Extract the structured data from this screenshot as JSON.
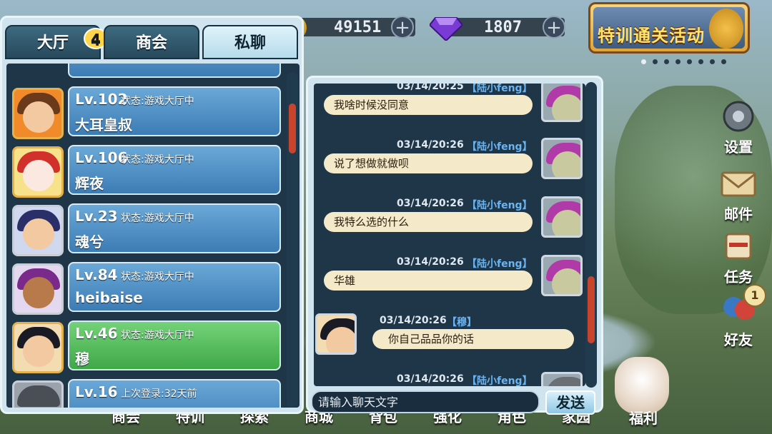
{
  "currency": {
    "coins": "49151",
    "gems": "1807"
  },
  "event_banner": {
    "title": "特训通关活动"
  },
  "side_menu": [
    {
      "label": "设置",
      "icon": "gear-icon"
    },
    {
      "label": "邮件",
      "icon": "mail-icon"
    },
    {
      "label": "任务",
      "icon": "scroll-icon"
    },
    {
      "label": "好友",
      "icon": "friends-icon",
      "badge": "1"
    }
  ],
  "bottom_nav": [
    "商会",
    "特训",
    "探索",
    "商城",
    "背包",
    "强化",
    "角色",
    "家园",
    "福利"
  ],
  "left_panel": {
    "tabs": [
      {
        "label": "大厅",
        "badge": "4"
      },
      {
        "label": "商会"
      },
      {
        "label": "私聊",
        "active": true
      }
    ],
    "friends": [
      {
        "level": "Lv.102",
        "status": "状态:游戏大厅中",
        "name": "大耳皇叔",
        "hl": false
      },
      {
        "level": "Lv.106",
        "status": "状态:游戏大厅中",
        "name": "辉夜",
        "hl": false
      },
      {
        "level": "Lv.23",
        "status": "状态:游戏大厅中",
        "name": "魂兮",
        "hl": false
      },
      {
        "level": "Lv.84",
        "status": "状态:游戏大厅中",
        "name": "heibaise",
        "hl": false
      },
      {
        "level": "Lv.46",
        "status": "状态:游戏大厅中",
        "name": "穆",
        "hl": true
      },
      {
        "level": "Lv.16",
        "status": "上次登录:32天前",
        "name": "",
        "hl": false
      }
    ]
  },
  "chat": {
    "messages": [
      {
        "time": "03/14/20:25",
        "name": "【陆小feng】",
        "text": "我啥时候没同意",
        "self": true
      },
      {
        "time": "03/14/20:26",
        "name": "【陆小feng】",
        "text": "说了想做就做呗",
        "self": true
      },
      {
        "time": "03/14/20:26",
        "name": "【陆小feng】",
        "text": "我特么选的什么",
        "self": true
      },
      {
        "time": "03/14/20:26",
        "name": "【陆小feng】",
        "text": "华雄",
        "self": true
      },
      {
        "time": "03/14/20:26",
        "name": "【穆】",
        "text": "你自己品品你的话",
        "self": false
      },
      {
        "time": "03/14/20:26",
        "name": "【陆小feng】",
        "text": "",
        "self": true
      }
    ],
    "input_placeholder": "请输入聊天文字",
    "send_label": "发送"
  }
}
